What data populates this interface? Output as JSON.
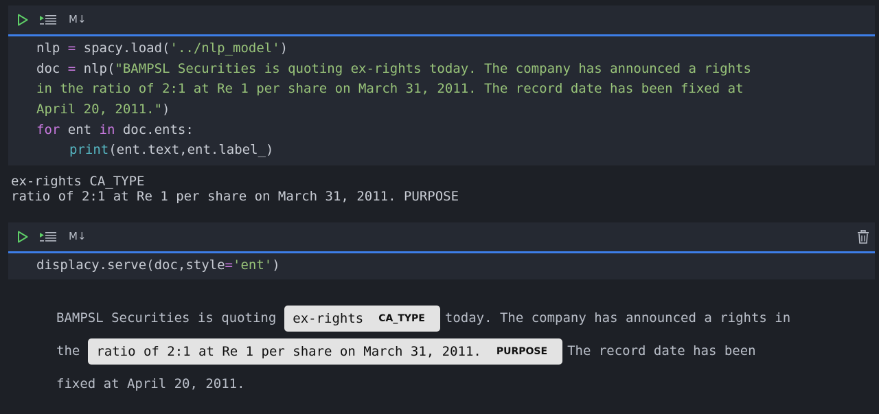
{
  "cell1": {
    "toolbar": {
      "md_label": "M↓"
    },
    "code": {
      "l1_a": "nlp ",
      "l1_op": "=",
      "l1_b": " spacy.load(",
      "l1_str": "'../nlp_model'",
      "l1_c": ")",
      "l2_a": "doc ",
      "l2_op": "=",
      "l2_b": " nlp(",
      "l2_str": "\"BAMPSL Securities is quoting ex-rights today. The company has announced a rights",
      "l3_str": "in the ratio of 2:1 at Re 1 per share on March 31, 2011. The record date has been fixed at",
      "l4_str": "April 20, 2011.\"",
      "l4_c": ")",
      "l5_kw1": "for",
      "l5_a": " ent ",
      "l5_kw2": "in",
      "l5_b": " doc.ents:",
      "l6_fn": "print",
      "l6_a": "(ent.text,ent.label_)"
    },
    "output": [
      "ex-rights CA_TYPE",
      "ratio of 2:1 at Re 1 per share on March 31, 2011. PURPOSE"
    ]
  },
  "cell2": {
    "toolbar": {
      "md_label": "M↓"
    },
    "code": {
      "l1_a": "displacy.serve(doc,style",
      "l1_op": "=",
      "l1_str": "'ent'",
      "l1_c": ")"
    },
    "displacy": {
      "line1_before": "BAMPSL Securities is quoting",
      "ent1_text": "ex-rights",
      "ent1_label": "CA_TYPE",
      "line1_after": "today. The company has announced a rights in",
      "line2_before": "the",
      "ent2_text": "ratio of 2:1 at Re 1 per share on March 31, 2011.",
      "ent2_label": "PURPOSE",
      "line2_after": "The record date has been",
      "line3": "fixed at April 20, 2011."
    }
  },
  "colors": {
    "accent": "#3d7ee8",
    "run_icon": "#5fd068",
    "keyword": "#c678dd",
    "string": "#98c379",
    "builtin": "#56b6c2",
    "entity_bg": "#e3e3e3"
  },
  "icons": [
    "run-icon",
    "run-below-icon",
    "markdown-toggle",
    "trash-icon"
  ]
}
